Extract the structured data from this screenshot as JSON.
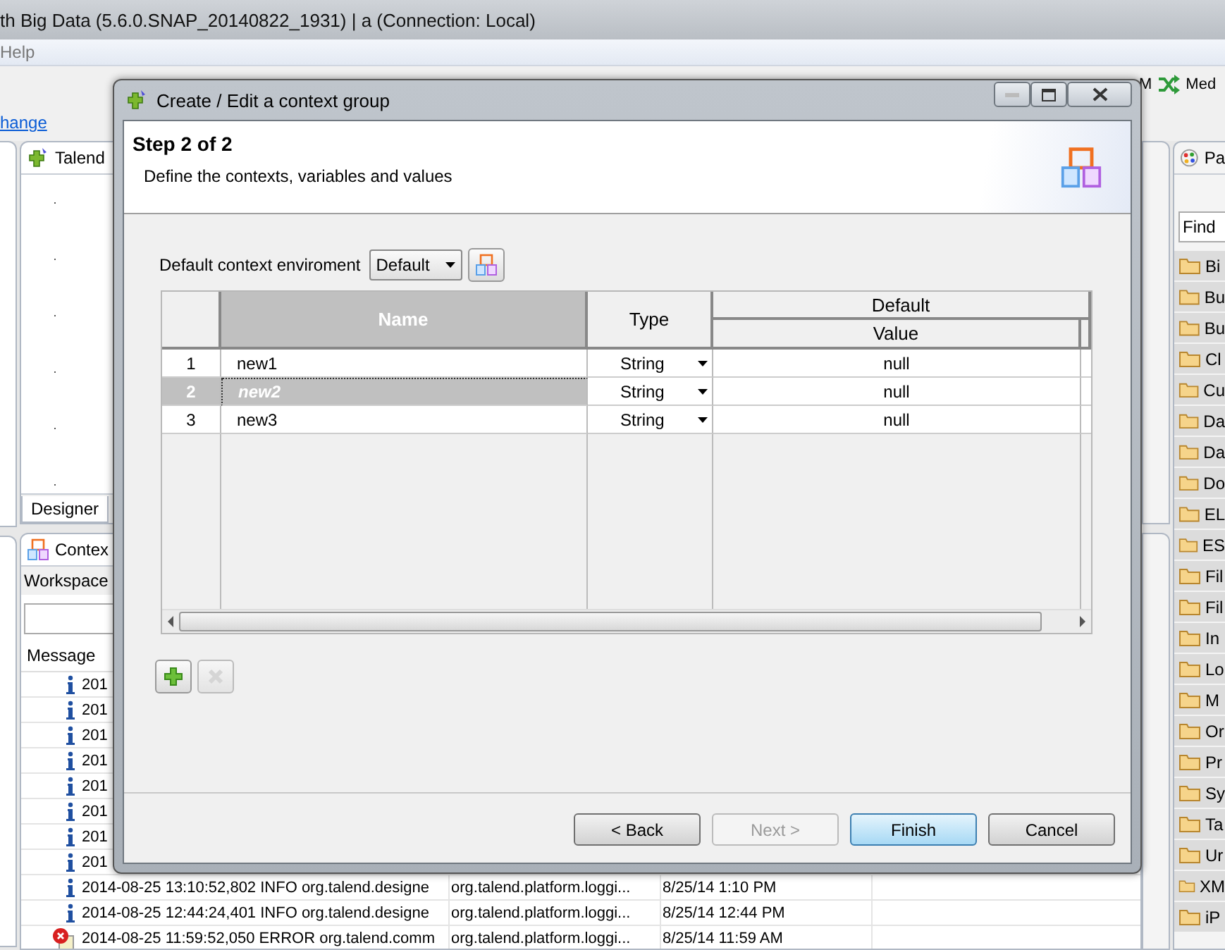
{
  "window": {
    "title": "th Big Data (5.6.0.SNAP_20140822_1931) | a (Connection: Local)"
  },
  "menu": [
    {
      "label": "Help"
    }
  ],
  "toolbar": {
    "link": "hange",
    "items": [
      {
        "label": "M",
        "kind": "text"
      },
      {
        "label": "Med",
        "kind": "icon"
      }
    ]
  },
  "editor": {
    "tab": "Talend",
    "bottom_tab": "Designer"
  },
  "context_panel": {
    "tab": "Contex",
    "scope": "Workspace",
    "columns": [
      "Message"
    ],
    "rows": [
      {
        "kind": "info",
        "message": "201"
      },
      {
        "kind": "info",
        "message": "201"
      },
      {
        "kind": "info",
        "message": "201"
      },
      {
        "kind": "info",
        "message": "201"
      },
      {
        "kind": "info",
        "message": "201"
      },
      {
        "kind": "info",
        "message": "201"
      },
      {
        "kind": "info",
        "message": "201"
      },
      {
        "kind": "info",
        "message": "201"
      },
      {
        "kind": "info",
        "message": "2014-08-25 13:10:52,802 INFO  org.talend.designe",
        "logger": "org.talend.platform.loggi...",
        "date": "8/25/14 1:10 PM"
      },
      {
        "kind": "info",
        "message": "2014-08-25 12:44:24,401 INFO  org.talend.designe",
        "logger": "org.talend.platform.loggi...",
        "date": "8/25/14 12:44 PM"
      },
      {
        "kind": "error",
        "message": "2014-08-25 11:59:52,050 ERROR org.talend.comm",
        "logger": "org.talend.platform.loggi...",
        "date": "8/25/14 11:59 AM"
      }
    ]
  },
  "palette": {
    "tab": "Pa",
    "search": "Find",
    "items": [
      "Bi",
      "Bu",
      "Bu",
      "Cl",
      "Cu",
      "Da",
      "Da",
      "Do",
      "EL",
      "ES",
      "Fil",
      "Fil",
      "In",
      "Lo",
      "M",
      "Or",
      "Pr",
      "Sy",
      "Ta",
      "Ur",
      "XM",
      "iP"
    ]
  },
  "dialog": {
    "title": "Create / Edit a context group",
    "step": "Step 2 of 2",
    "description": "Define the contexts, variables and values",
    "default_label": "Default context enviroment",
    "default_value": "Default",
    "columns": [
      {
        "label": "Name",
        "selected": true
      },
      {
        "label": "Type",
        "selected": false
      }
    ],
    "group": {
      "label": "Default",
      "sub": "Value"
    },
    "rows": [
      {
        "number": "1",
        "name": "new1",
        "type": "String",
        "value": "null",
        "selected": false
      },
      {
        "number": "2",
        "name": "new2",
        "type": "String",
        "value": "null",
        "selected": true
      },
      {
        "number": "3",
        "name": "new3",
        "type": "String",
        "value": "null",
        "selected": false
      }
    ],
    "actions": [
      {
        "kind": "add",
        "disabled": false
      },
      {
        "kind": "remove",
        "disabled": true
      }
    ],
    "buttons": [
      {
        "label": "< Back",
        "disabled": false,
        "focused": false
      },
      {
        "label": "Next >",
        "disabled": true,
        "focused": false
      },
      {
        "label": "Finish",
        "disabled": false,
        "focused": true
      },
      {
        "label": "Cancel",
        "disabled": false,
        "focused": false
      }
    ]
  }
}
